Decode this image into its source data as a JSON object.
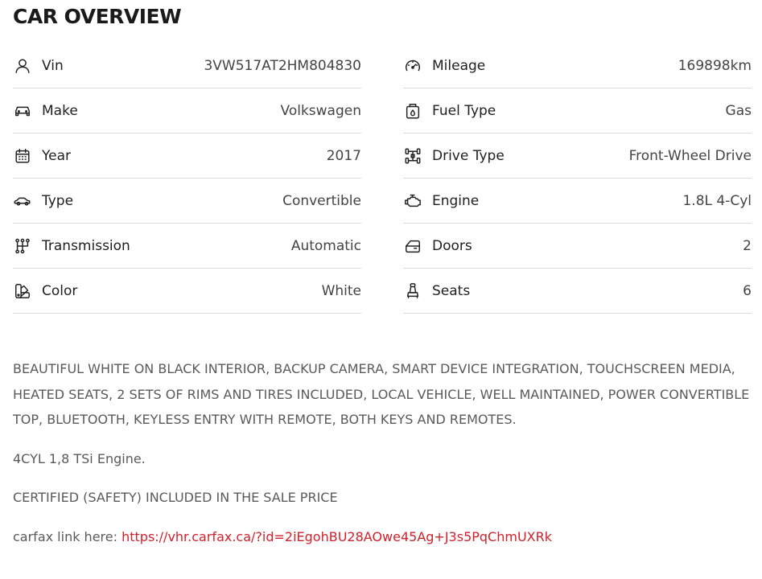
{
  "page": {
    "title": "CAR OVERVIEW"
  },
  "specs": {
    "left": [
      {
        "label": "Vin",
        "value": "3VW517AT2HM804830",
        "icon": "person-icon"
      },
      {
        "label": "Make",
        "value": "Volkswagen",
        "icon": "car-front-icon"
      },
      {
        "label": "Year",
        "value": "2017",
        "icon": "calendar-icon"
      },
      {
        "label": "Type",
        "value": "Convertible",
        "icon": "car-side-icon"
      },
      {
        "label": "Transmission",
        "value": "Automatic",
        "icon": "gear-shift-icon"
      },
      {
        "label": "Color",
        "value": "White",
        "icon": "color-swatch-icon"
      }
    ],
    "right": [
      {
        "label": "Mileage",
        "value": "169898km",
        "icon": "speedometer-icon"
      },
      {
        "label": "Fuel Type",
        "value": "Gas",
        "icon": "fuel-can-icon"
      },
      {
        "label": "Drive Type",
        "value": "Front-Wheel Drive",
        "icon": "drivetrain-icon"
      },
      {
        "label": "Engine",
        "value": "1.8L 4-Cyl",
        "icon": "engine-icon"
      },
      {
        "label": "Doors",
        "value": "2",
        "icon": "car-door-icon"
      },
      {
        "label": "Seats",
        "value": "6",
        "icon": "seat-icon"
      }
    ]
  },
  "description": {
    "paragraph1": "BEAUTIFUL WHITE ON BLACK INTERIOR, BACKUP CAMERA, SMART DEVICE INTEGRATION, TOUCHSCREEN MEDIA, HEATED SEATS, 2 SETS OF RIMS AND TIRES INCLUDED, LOCAL VEHICLE, WELL MAINTAINED, POWER CONVERTIBLE TOP, BLUETOOTH, KEYLESS ENTRY WITH REMOTE, BOTH KEYS AND REMOTES.",
    "paragraph2": "4CYL 1,8 TSi Engine.",
    "paragraph3": "CERTIFIED (SAFETY) INCLUDED IN THE SALE PRICE",
    "carfax_prefix": "carfax link here: ",
    "carfax_link": "https://vhr.carfax.ca/?id=2iEgohBU28AOwe45Ag+J3s5PqChmUXRk"
  },
  "colors": {
    "link": "#d0212b",
    "divider": "#dcdcdc"
  }
}
